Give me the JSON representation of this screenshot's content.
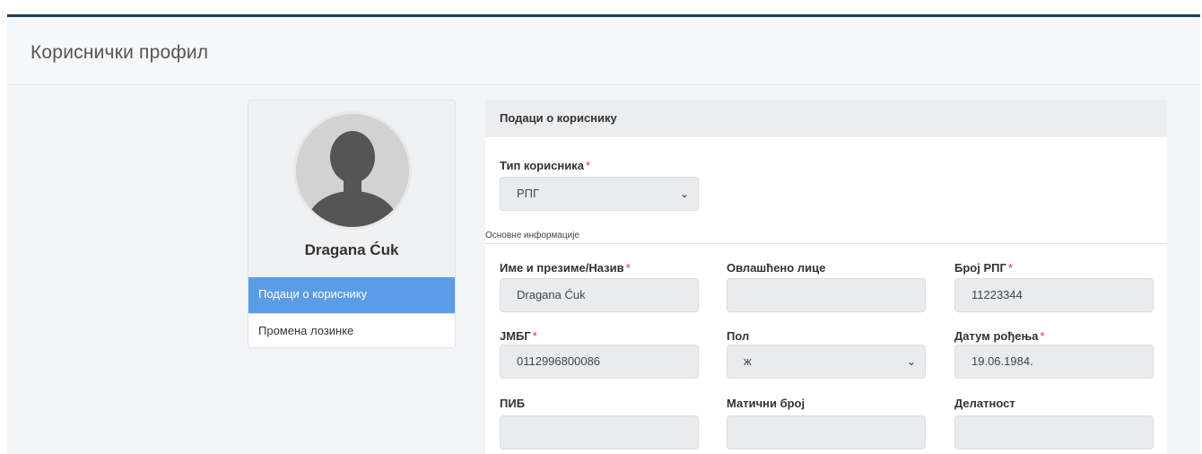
{
  "page": {
    "title": "Кориснички профил"
  },
  "profile": {
    "name": "Dragana Ćuk",
    "menu": [
      {
        "label": "Подаци о кориснику",
        "active": true
      },
      {
        "label": "Промена лозинке",
        "active": false
      }
    ]
  },
  "form": {
    "header": "Подаци о кориснику",
    "user_type": {
      "label": "Тип корисника",
      "required": "*",
      "value": "РПГ"
    },
    "section": "Основне информације",
    "fields": {
      "name": {
        "label": "Име и презиме/Назив",
        "required": "*",
        "value": "Dragana Ćuk"
      },
      "authorized_person": {
        "label": "Овлашћено лице",
        "value": ""
      },
      "rpg_number": {
        "label": "Број РПГ",
        "required": "*",
        "value": "11223344"
      },
      "jmbg": {
        "label": "ЈМБГ",
        "required": "*",
        "value": "0112996800086"
      },
      "gender": {
        "label": "Пол",
        "value": "ж"
      },
      "birth_date": {
        "label": "Датум рођења",
        "required": "*",
        "value": "19.06.1984."
      },
      "pib": {
        "label": "ПИБ",
        "value": ""
      },
      "registry_number": {
        "label": "Матични број",
        "value": ""
      },
      "activity": {
        "label": "Делатност",
        "value": ""
      }
    }
  },
  "icons": {
    "select_arrow": "chevron-down-icon",
    "avatar": "user-silhouette"
  },
  "colors": {
    "accent": "#5b9ce6",
    "required": "#e0342f",
    "topbar": "#1f3b5c"
  }
}
